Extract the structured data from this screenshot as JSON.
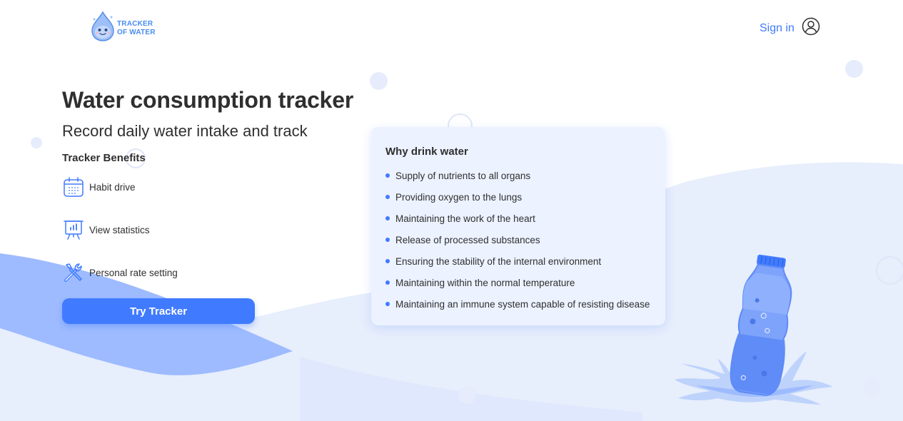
{
  "brand": {
    "line1": "TRACKER",
    "line2": "OF WATER",
    "logo_icon": "water-drop-mascot-icon"
  },
  "header": {
    "signin_label": "Sign in",
    "user_icon": "user-circle-icon"
  },
  "hero": {
    "title": "Water consumption tracker",
    "subtitle": "Record daily water intake and track",
    "benefits_heading": "Tracker Benefits",
    "benefits": [
      {
        "label": "Habit drive",
        "icon": "calendar-icon"
      },
      {
        "label": "View statistics",
        "icon": "presentation-chart-icon"
      },
      {
        "label": "Personal rate setting",
        "icon": "tools-icon"
      }
    ],
    "cta_label": "Try Tracker"
  },
  "card": {
    "title": "Why drink water",
    "items": [
      "Supply of nutrients to all organs",
      "Providing oxygen to the lungs",
      "Maintaining the work of the heart",
      "Release of processed substances",
      "Ensuring the stability of the internal environment",
      "Maintaining within the normal temperature",
      "Maintaining an immune system capable of resisting disease"
    ]
  },
  "illustration": {
    "icon": "water-bottle-splash-icon"
  },
  "colors": {
    "accent": "#407BFF",
    "card_bg": "#ECF2FF",
    "wave_light": "#DCE6FC",
    "wave_dark": "#9EBBFF",
    "text": "#2F2F2F"
  }
}
